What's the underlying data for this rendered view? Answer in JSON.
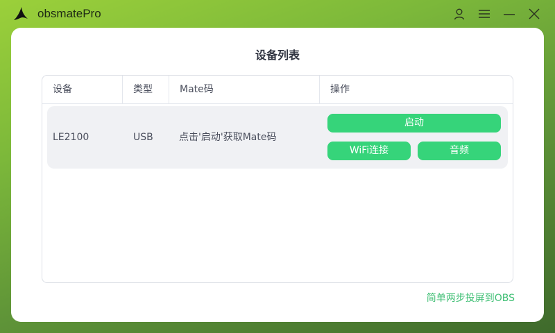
{
  "app": {
    "title": "obsmatePro",
    "logo_icon": "bird-logo-icon"
  },
  "titlebar": {
    "icons": [
      "user-icon",
      "menu-icon",
      "minimize-icon",
      "close-icon"
    ]
  },
  "page": {
    "title": "设备列表"
  },
  "table": {
    "columns": [
      "设备",
      "类型",
      "Mate码",
      "操作"
    ],
    "rows": [
      {
        "device": "LE2100",
        "type": "USB",
        "mate_code": "点击'启动'获取Mate码",
        "actions": {
          "start": "启动",
          "wifi": "WiFi连接",
          "audio": "音频"
        }
      }
    ]
  },
  "footer": {
    "link": "简单两步投屏到OBS"
  },
  "colors": {
    "accent": "#36d47a",
    "footer_link": "#3fbf74",
    "text": "#4a4e5c",
    "title": "#2f3340"
  }
}
